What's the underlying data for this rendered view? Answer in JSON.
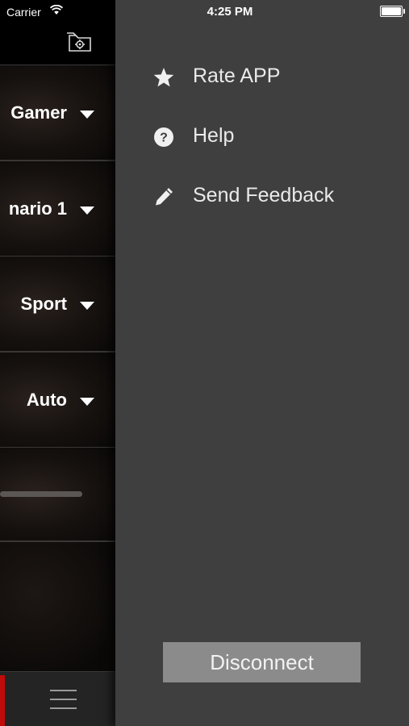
{
  "status_bar": {
    "carrier": "Carrier",
    "time": "4:25 PM",
    "icons": [
      "wifi-icon",
      "battery-icon"
    ]
  },
  "left_panel": {
    "header_icon": "folder-gear-icon",
    "rows": [
      {
        "value": "Gamer"
      },
      {
        "value": "nario 1"
      },
      {
        "value": "Sport"
      },
      {
        "value": "Auto"
      }
    ],
    "bottom_bar": {
      "menu_icon": "hamburger-menu-icon",
      "indicator_color": "#c10a0a"
    }
  },
  "drawer": {
    "items": [
      {
        "label": "Rate APP",
        "icon": "star-icon"
      },
      {
        "label": "Help",
        "icon": "help-icon"
      },
      {
        "label": "Send Feedback",
        "icon": "pencil-icon"
      }
    ],
    "disconnect_label": "Disconnect"
  },
  "colors": {
    "drawer_bg": "#3f3f3f",
    "left_bg": "#0b0908",
    "button_bg": "#8b8b8b",
    "accent_red": "#c10a0a"
  }
}
